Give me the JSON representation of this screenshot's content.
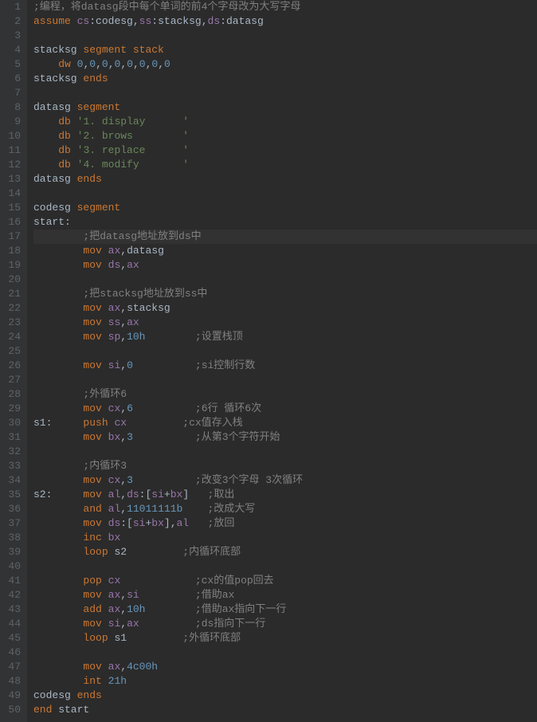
{
  "lines": [
    {
      "n": 1,
      "tokens": [
        {
          "t": ";编程，将datasg段中每个单词的前4个字母改为大写字母",
          "c": "cmt"
        }
      ]
    },
    {
      "n": 2,
      "tokens": [
        {
          "t": "assume",
          "c": "kw"
        },
        {
          "t": " "
        },
        {
          "t": "cs",
          "c": "reg"
        },
        {
          "t": ":"
        },
        {
          "t": "codesg",
          "c": "lbl"
        },
        {
          "t": ","
        },
        {
          "t": "ss",
          "c": "reg"
        },
        {
          "t": ":"
        },
        {
          "t": "stacksg",
          "c": "lbl"
        },
        {
          "t": ","
        },
        {
          "t": "ds",
          "c": "reg"
        },
        {
          "t": ":"
        },
        {
          "t": "datasg",
          "c": "lbl"
        }
      ]
    },
    {
      "n": 3,
      "tokens": []
    },
    {
      "n": 4,
      "tokens": [
        {
          "t": "stacksg ",
          "c": "lbl"
        },
        {
          "t": "segment",
          "c": "kw"
        },
        {
          "t": " "
        },
        {
          "t": "stack",
          "c": "kw"
        }
      ]
    },
    {
      "n": 5,
      "tokens": [
        {
          "t": "    "
        },
        {
          "t": "dw",
          "c": "kw"
        },
        {
          "t": " "
        },
        {
          "t": "0",
          "c": "num"
        },
        {
          "t": ","
        },
        {
          "t": "0",
          "c": "num"
        },
        {
          "t": ","
        },
        {
          "t": "0",
          "c": "num"
        },
        {
          "t": ","
        },
        {
          "t": "0",
          "c": "num"
        },
        {
          "t": ","
        },
        {
          "t": "0",
          "c": "num"
        },
        {
          "t": ","
        },
        {
          "t": "0",
          "c": "num"
        },
        {
          "t": ","
        },
        {
          "t": "0",
          "c": "num"
        },
        {
          "t": ","
        },
        {
          "t": "0",
          "c": "num"
        }
      ]
    },
    {
      "n": 6,
      "tokens": [
        {
          "t": "stacksg ",
          "c": "lbl"
        },
        {
          "t": "ends",
          "c": "kw"
        }
      ]
    },
    {
      "n": 7,
      "tokens": []
    },
    {
      "n": 8,
      "tokens": [
        {
          "t": "datasg ",
          "c": "lbl"
        },
        {
          "t": "segment",
          "c": "kw"
        }
      ]
    },
    {
      "n": 9,
      "tokens": [
        {
          "t": "    "
        },
        {
          "t": "db",
          "c": "kw"
        },
        {
          "t": " "
        },
        {
          "t": "'1. display      '",
          "c": "str"
        }
      ]
    },
    {
      "n": 10,
      "tokens": [
        {
          "t": "    "
        },
        {
          "t": "db",
          "c": "kw"
        },
        {
          "t": " "
        },
        {
          "t": "'2. brows        '",
          "c": "str"
        }
      ]
    },
    {
      "n": 11,
      "tokens": [
        {
          "t": "    "
        },
        {
          "t": "db",
          "c": "kw"
        },
        {
          "t": " "
        },
        {
          "t": "'3. replace      '",
          "c": "str"
        }
      ]
    },
    {
      "n": 12,
      "tokens": [
        {
          "t": "    "
        },
        {
          "t": "db",
          "c": "kw"
        },
        {
          "t": " "
        },
        {
          "t": "'4. modify       '",
          "c": "str"
        }
      ]
    },
    {
      "n": 13,
      "tokens": [
        {
          "t": "datasg ",
          "c": "lbl"
        },
        {
          "t": "ends",
          "c": "kw"
        }
      ]
    },
    {
      "n": 14,
      "tokens": []
    },
    {
      "n": 15,
      "tokens": [
        {
          "t": "codesg ",
          "c": "lbl"
        },
        {
          "t": "segment",
          "c": "kw"
        }
      ]
    },
    {
      "n": 16,
      "tokens": [
        {
          "t": "start:",
          "c": "lbl"
        }
      ]
    },
    {
      "n": 17,
      "cursor": true,
      "tokens": [
        {
          "t": "        "
        },
        {
          "t": ";把datasg地址放到ds中",
          "c": "cmt"
        }
      ]
    },
    {
      "n": 18,
      "tokens": [
        {
          "t": "        "
        },
        {
          "t": "mov",
          "c": "ins"
        },
        {
          "t": " "
        },
        {
          "t": "ax",
          "c": "reg"
        },
        {
          "t": ","
        },
        {
          "t": "datasg",
          "c": "lbl"
        }
      ]
    },
    {
      "n": 19,
      "tokens": [
        {
          "t": "        "
        },
        {
          "t": "mov",
          "c": "ins"
        },
        {
          "t": " "
        },
        {
          "t": "ds",
          "c": "reg"
        },
        {
          "t": ","
        },
        {
          "t": "ax",
          "c": "reg"
        }
      ]
    },
    {
      "n": 20,
      "tokens": []
    },
    {
      "n": 21,
      "tokens": [
        {
          "t": "        "
        },
        {
          "t": ";把stacksg地址放到ss中",
          "c": "cmt"
        }
      ]
    },
    {
      "n": 22,
      "tokens": [
        {
          "t": "        "
        },
        {
          "t": "mov",
          "c": "ins"
        },
        {
          "t": " "
        },
        {
          "t": "ax",
          "c": "reg"
        },
        {
          "t": ","
        },
        {
          "t": "stacksg",
          "c": "lbl"
        }
      ]
    },
    {
      "n": 23,
      "tokens": [
        {
          "t": "        "
        },
        {
          "t": "mov",
          "c": "ins"
        },
        {
          "t": " "
        },
        {
          "t": "ss",
          "c": "reg"
        },
        {
          "t": ","
        },
        {
          "t": "ax",
          "c": "reg"
        }
      ]
    },
    {
      "n": 24,
      "tokens": [
        {
          "t": "        "
        },
        {
          "t": "mov",
          "c": "ins"
        },
        {
          "t": " "
        },
        {
          "t": "sp",
          "c": "reg"
        },
        {
          "t": ","
        },
        {
          "t": "10h",
          "c": "num"
        },
        {
          "t": "        "
        },
        {
          "t": ";设置栈顶",
          "c": "cmt"
        }
      ]
    },
    {
      "n": 25,
      "tokens": []
    },
    {
      "n": 26,
      "tokens": [
        {
          "t": "        "
        },
        {
          "t": "mov",
          "c": "ins"
        },
        {
          "t": " "
        },
        {
          "t": "si",
          "c": "reg"
        },
        {
          "t": ","
        },
        {
          "t": "0",
          "c": "num"
        },
        {
          "t": "          "
        },
        {
          "t": ";si控制行数",
          "c": "cmt"
        }
      ]
    },
    {
      "n": 27,
      "tokens": []
    },
    {
      "n": 28,
      "tokens": [
        {
          "t": "        "
        },
        {
          "t": ";外循环6",
          "c": "cmt"
        }
      ]
    },
    {
      "n": 29,
      "tokens": [
        {
          "t": "        "
        },
        {
          "t": "mov",
          "c": "ins"
        },
        {
          "t": " "
        },
        {
          "t": "cx",
          "c": "reg"
        },
        {
          "t": ","
        },
        {
          "t": "6",
          "c": "num"
        },
        {
          "t": "          "
        },
        {
          "t": ";6行 循环6次",
          "c": "cmt"
        }
      ]
    },
    {
      "n": 30,
      "tokens": [
        {
          "t": "s1:     ",
          "c": "lbl"
        },
        {
          "t": "push",
          "c": "ins"
        },
        {
          "t": " "
        },
        {
          "t": "cx",
          "c": "reg"
        },
        {
          "t": "         "
        },
        {
          "t": ";cx值存入栈",
          "c": "cmt"
        }
      ]
    },
    {
      "n": 31,
      "tokens": [
        {
          "t": "        "
        },
        {
          "t": "mov",
          "c": "ins"
        },
        {
          "t": " "
        },
        {
          "t": "bx",
          "c": "reg"
        },
        {
          "t": ","
        },
        {
          "t": "3",
          "c": "num"
        },
        {
          "t": "          "
        },
        {
          "t": ";从第3个字符开始",
          "c": "cmt"
        }
      ]
    },
    {
      "n": 32,
      "tokens": []
    },
    {
      "n": 33,
      "tokens": [
        {
          "t": "        "
        },
        {
          "t": ";内循环3",
          "c": "cmt"
        }
      ]
    },
    {
      "n": 34,
      "tokens": [
        {
          "t": "        "
        },
        {
          "t": "mov",
          "c": "ins"
        },
        {
          "t": " "
        },
        {
          "t": "cx",
          "c": "reg"
        },
        {
          "t": ","
        },
        {
          "t": "3",
          "c": "num"
        },
        {
          "t": "          "
        },
        {
          "t": ";改变3个字母 3次循环",
          "c": "cmt"
        }
      ]
    },
    {
      "n": 35,
      "tokens": [
        {
          "t": "s2:     ",
          "c": "lbl"
        },
        {
          "t": "mov",
          "c": "ins"
        },
        {
          "t": " "
        },
        {
          "t": "al",
          "c": "reg"
        },
        {
          "t": ","
        },
        {
          "t": "ds",
          "c": "reg"
        },
        {
          "t": ":["
        },
        {
          "t": "si",
          "c": "reg"
        },
        {
          "t": "+"
        },
        {
          "t": "bx",
          "c": "reg"
        },
        {
          "t": "]   "
        },
        {
          "t": ";取出",
          "c": "cmt"
        }
      ]
    },
    {
      "n": 36,
      "tokens": [
        {
          "t": "        "
        },
        {
          "t": "and",
          "c": "ins"
        },
        {
          "t": " "
        },
        {
          "t": "al",
          "c": "reg"
        },
        {
          "t": ","
        },
        {
          "t": "11011111b",
          "c": "num"
        },
        {
          "t": "    "
        },
        {
          "t": ";改成大写",
          "c": "cmt"
        }
      ]
    },
    {
      "n": 37,
      "tokens": [
        {
          "t": "        "
        },
        {
          "t": "mov",
          "c": "ins"
        },
        {
          "t": " "
        },
        {
          "t": "ds",
          "c": "reg"
        },
        {
          "t": ":["
        },
        {
          "t": "si",
          "c": "reg"
        },
        {
          "t": "+"
        },
        {
          "t": "bx",
          "c": "reg"
        },
        {
          "t": "],"
        },
        {
          "t": "al",
          "c": "reg"
        },
        {
          "t": "   "
        },
        {
          "t": ";放回",
          "c": "cmt"
        }
      ]
    },
    {
      "n": 38,
      "tokens": [
        {
          "t": "        "
        },
        {
          "t": "inc",
          "c": "ins"
        },
        {
          "t": " "
        },
        {
          "t": "bx",
          "c": "reg"
        }
      ]
    },
    {
      "n": 39,
      "tokens": [
        {
          "t": "        "
        },
        {
          "t": "loop",
          "c": "ins"
        },
        {
          "t": " s2         "
        },
        {
          "t": ";内循环底部",
          "c": "cmt"
        }
      ]
    },
    {
      "n": 40,
      "tokens": []
    },
    {
      "n": 41,
      "tokens": [
        {
          "t": "        "
        },
        {
          "t": "pop",
          "c": "ins"
        },
        {
          "t": " "
        },
        {
          "t": "cx",
          "c": "reg"
        },
        {
          "t": "            "
        },
        {
          "t": ";cx的值pop回去",
          "c": "cmt"
        }
      ]
    },
    {
      "n": 42,
      "tokens": [
        {
          "t": "        "
        },
        {
          "t": "mov",
          "c": "ins"
        },
        {
          "t": " "
        },
        {
          "t": "ax",
          "c": "reg"
        },
        {
          "t": ","
        },
        {
          "t": "si",
          "c": "reg"
        },
        {
          "t": "         "
        },
        {
          "t": ";借助ax",
          "c": "cmt"
        }
      ]
    },
    {
      "n": 43,
      "tokens": [
        {
          "t": "        "
        },
        {
          "t": "add",
          "c": "ins"
        },
        {
          "t": " "
        },
        {
          "t": "ax",
          "c": "reg"
        },
        {
          "t": ","
        },
        {
          "t": "10h",
          "c": "num"
        },
        {
          "t": "        "
        },
        {
          "t": ";借助ax指向下一行",
          "c": "cmt"
        }
      ]
    },
    {
      "n": 44,
      "tokens": [
        {
          "t": "        "
        },
        {
          "t": "mov",
          "c": "ins"
        },
        {
          "t": " "
        },
        {
          "t": "si",
          "c": "reg"
        },
        {
          "t": ","
        },
        {
          "t": "ax",
          "c": "reg"
        },
        {
          "t": "         "
        },
        {
          "t": ";ds指向下一行",
          "c": "cmt"
        }
      ]
    },
    {
      "n": 45,
      "tokens": [
        {
          "t": "        "
        },
        {
          "t": "loop",
          "c": "ins"
        },
        {
          "t": " s1         "
        },
        {
          "t": ";外循环底部",
          "c": "cmt"
        }
      ]
    },
    {
      "n": 46,
      "tokens": []
    },
    {
      "n": 47,
      "tokens": [
        {
          "t": "        "
        },
        {
          "t": "mov",
          "c": "ins"
        },
        {
          "t": " "
        },
        {
          "t": "ax",
          "c": "reg"
        },
        {
          "t": ","
        },
        {
          "t": "4c00h",
          "c": "num"
        }
      ]
    },
    {
      "n": 48,
      "tokens": [
        {
          "t": "        "
        },
        {
          "t": "int",
          "c": "ins"
        },
        {
          "t": " "
        },
        {
          "t": "21h",
          "c": "num"
        }
      ]
    },
    {
      "n": 49,
      "tokens": [
        {
          "t": "codesg ",
          "c": "lbl"
        },
        {
          "t": "ends",
          "c": "kw"
        }
      ]
    },
    {
      "n": 50,
      "tokens": [
        {
          "t": "end",
          "c": "kw"
        },
        {
          "t": " start"
        }
      ]
    }
  ]
}
